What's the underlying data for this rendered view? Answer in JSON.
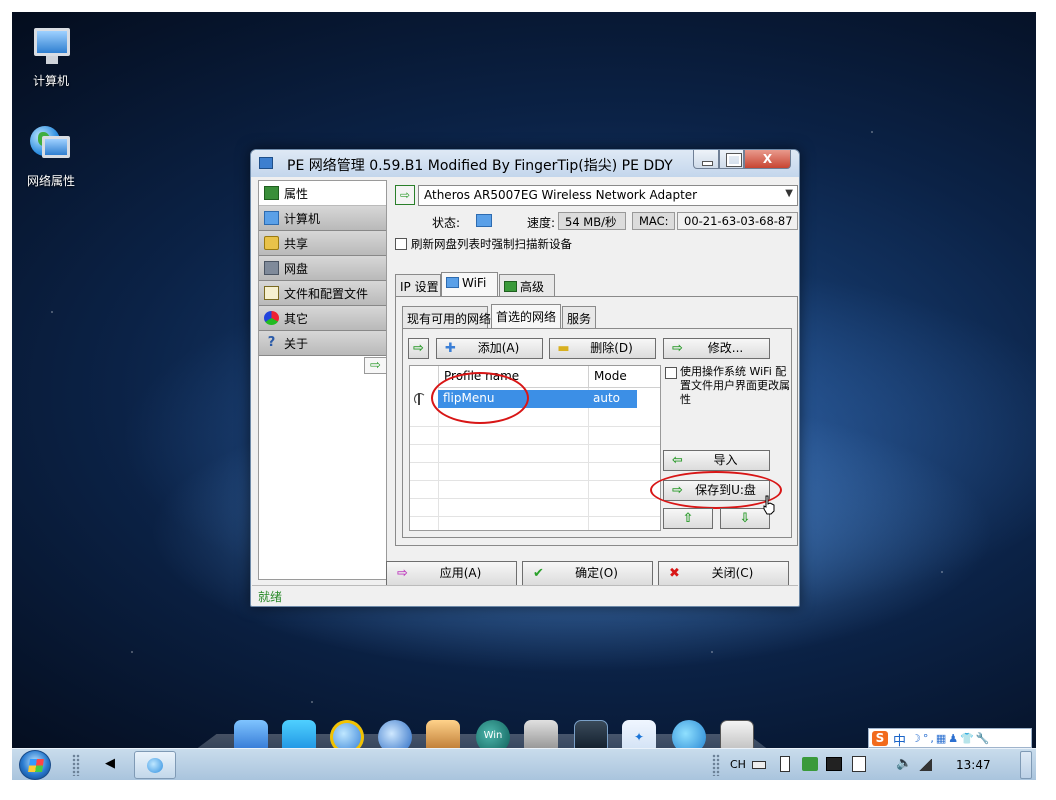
{
  "desktop": {
    "icons": [
      {
        "label": "计算机",
        "icon": "computer-icon"
      },
      {
        "label": "网络属性",
        "icon": "network-globe-icon"
      }
    ]
  },
  "window": {
    "title": "PE 网络管理 0.59.B1 Modified By FingerTip(指尖) PE DDY",
    "close_glyph": "X"
  },
  "nav": {
    "items": [
      {
        "label": "属性",
        "icon": "properties-icon",
        "active": true
      },
      {
        "label": "计算机",
        "icon": "computer-icon"
      },
      {
        "label": "共享",
        "icon": "share-icon"
      },
      {
        "label": "网盘",
        "icon": "network-drive-icon"
      },
      {
        "label": "文件和配置文件",
        "icon": "file-config-icon"
      },
      {
        "label": "其它",
        "icon": "other-icon"
      },
      {
        "label": "关于",
        "icon": "help-icon"
      }
    ],
    "arrow_glyph": "⇨"
  },
  "adapter": {
    "selected": "Atheros AR5007EG Wireless Network Adapter",
    "status_label": "状态:",
    "speed_label": "速度:",
    "speed_value": "54 MB/秒",
    "mac_label": "MAC:",
    "mac_value": "00-21-63-03-68-87",
    "force_refresh_label": "刷新网盘列表时强制扫描新设备"
  },
  "tabs": {
    "outer": [
      "IP 设置",
      "WiFi",
      "高级"
    ],
    "outer_selected": "WiFi",
    "inner": [
      "现有可用的网络",
      "首选的网络",
      "服务"
    ],
    "inner_selected": "首选的网络"
  },
  "toolbar": {
    "add_label": "添加(A)",
    "delete_label": "删除(D)",
    "modify_label": "修改...",
    "add_glyph": "✚",
    "delete_glyph": "▬",
    "modify_glyph": "⇨"
  },
  "profiles": {
    "columns": [
      "Profile name",
      "Mode"
    ],
    "rows": [
      {
        "name": "flipMenu",
        "mode": "auto",
        "selected": true
      }
    ]
  },
  "side_options": {
    "use_os_config_label": "使用操作系统 WiFi 配置文件用户界面更改属性",
    "import_label": "导入",
    "save_usb_label": "保存到U:盘",
    "up_glyph": "⇧",
    "down_glyph": "⇩"
  },
  "actions": {
    "apply_label": "应用(A)",
    "ok_label": "确定(O)",
    "close_label": "关闭(C)",
    "apply_glyph": "⇨",
    "ok_glyph": "✔",
    "close_glyph": "✖"
  },
  "statusbar": {
    "text": "就绪"
  },
  "dock": {
    "apps": [
      "finder-icon",
      "window-switch-icon",
      "ie-icon",
      "media-player-icon",
      "photos-icon",
      "win-icon",
      "disk-utility-icon",
      "activity-monitor-icon",
      "dropbox-icon",
      "grid-apps-icon",
      "screen-icon"
    ],
    "win_label": "Win"
  },
  "taskbar": {
    "lang": "CH",
    "clock": "13:47"
  },
  "ime": {
    "s_glyph": "S",
    "lang_label": "中",
    "extras": "☽°,▦♟👕🔧"
  },
  "colors": {
    "selection": "#3c8fe6",
    "annotation_red": "#d81616",
    "status_green": "#2a8a2a"
  }
}
